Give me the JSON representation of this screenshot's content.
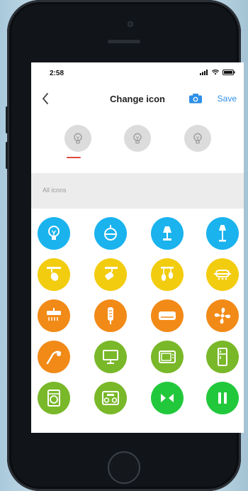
{
  "status": {
    "time": "2:58"
  },
  "nav": {
    "title": "Change icon",
    "save_label": "Save",
    "back_icon": "chevron-left-icon"
  },
  "section": {
    "all_icons_label": "All icons"
  },
  "selected_preview_index": 0,
  "colors": {
    "accent": "#2e8fe6",
    "selected_underline": "#e04a3f",
    "blue": "#1ab3ee",
    "yellow": "#f2cc0f",
    "orange": "#f28a17",
    "green": "#79b829",
    "bright_green": "#22c83c"
  },
  "previews": [
    "bulb-icon",
    "bulb-icon",
    "bulb-icon"
  ],
  "icon_rows": [
    [
      "bulb-icon",
      "pendant-lamp-icon",
      "table-lamp-icon",
      "floor-lamp-icon"
    ],
    [
      "spotlight-icon",
      "track-light-icon",
      "chandelier-icon",
      "ceiling-light-icon"
    ],
    [
      "shower-heater-icon",
      "radiator-icon",
      "air-conditioner-icon",
      "fan-icon"
    ],
    [
      "hair-dryer-icon",
      "monitor-icon",
      "tv-icon",
      "fridge-icon"
    ],
    [
      "washing-machine-icon",
      "stereo-icon",
      "curtain-icon",
      "pause-switch-icon"
    ]
  ],
  "row_colors": [
    "blue",
    "yellow",
    "orange",
    "mixed",
    "mixed"
  ]
}
